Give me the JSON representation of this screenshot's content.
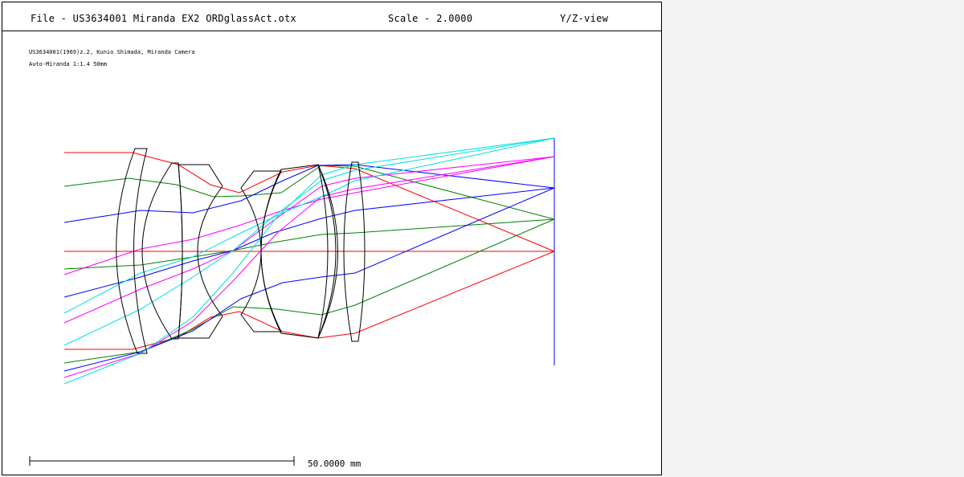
{
  "header": {
    "file_label": "File - US3634001 Miranda EX2 ORDglassAct.otx",
    "scale_label": "Scale - 2.0000",
    "view_label": "Y/Z-view"
  },
  "description": {
    "line1": "US3634001(1969)z.2, Kunio Shimada, Miranda Camera",
    "line2": "Auto-Miranda 1:1.4 50mm"
  },
  "scale_bar": {
    "label": "50.0000 mm"
  },
  "colors": {
    "field_0": "#ff0000",
    "field_1": "#008000",
    "field_2": "#0000ff",
    "field_3": "#ff00ff",
    "field_4": "#00e0e0",
    "lens": "#000000"
  }
}
